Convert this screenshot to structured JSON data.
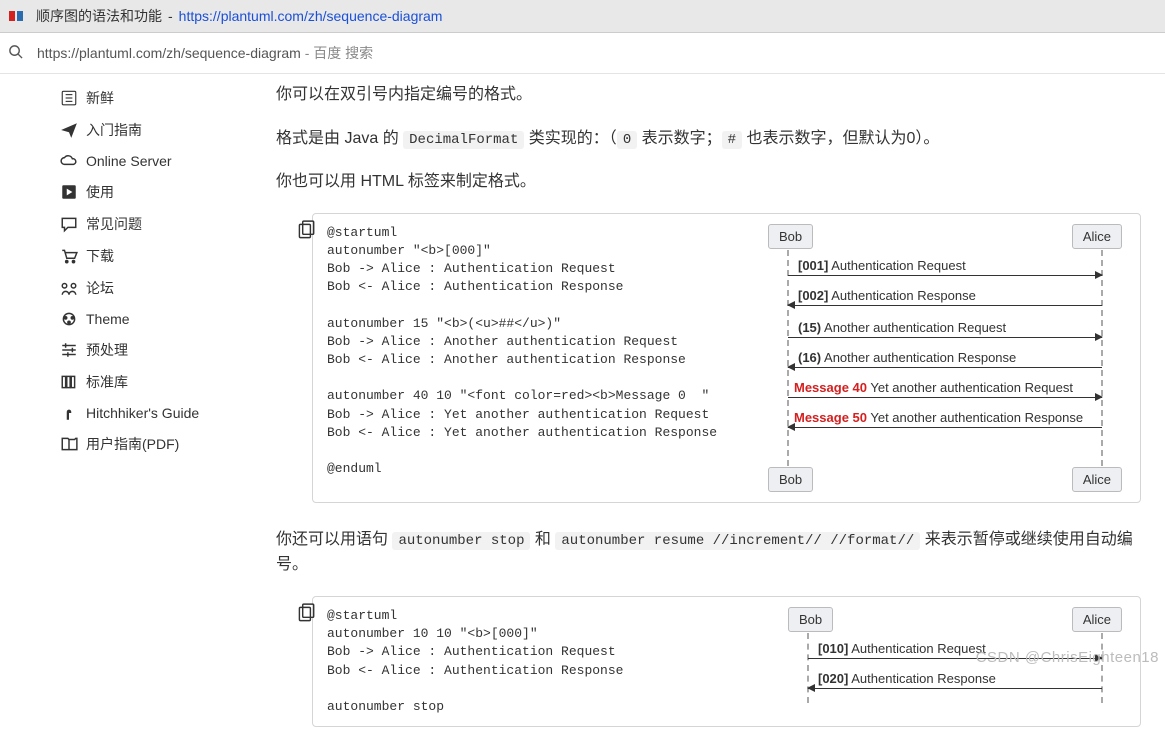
{
  "topbar": {
    "title": "顺序图的语法和功能",
    "sep": " - ",
    "url": "https://plantuml.com/zh/sequence-diagram"
  },
  "search": {
    "url": "https://plantuml.com/zh/sequence-diagram",
    "sep": " - ",
    "suffix": "百度 搜索"
  },
  "sidebar": {
    "items": [
      {
        "icon": "doc-icon",
        "label": "新鲜"
      },
      {
        "icon": "plane-icon",
        "label": "入门指南"
      },
      {
        "icon": "cloud-icon",
        "label": "Online Server"
      },
      {
        "icon": "play-icon",
        "label": "使用"
      },
      {
        "icon": "chat-icon",
        "label": "常见问题"
      },
      {
        "icon": "cart-icon",
        "label": "下载"
      },
      {
        "icon": "forum-icon",
        "label": "论坛"
      },
      {
        "icon": "theme-icon",
        "label": "Theme"
      },
      {
        "icon": "preprocess-icon",
        "label": "预处理"
      },
      {
        "icon": "library-icon",
        "label": "标准库"
      },
      {
        "icon": "hitchhiker-icon",
        "label": "Hitchhiker's Guide"
      },
      {
        "icon": "pdf-icon",
        "label": "用户指南(PDF)"
      }
    ]
  },
  "content": {
    "p1": "你可以在双引号内指定编号的格式。",
    "p2_a": "格式是由 Java 的 ",
    "p2_code": "DecimalFormat",
    "p2_b": " 类实现的：（",
    "p2_code2": "0",
    "p2_c": " 表示数字；",
    "p2_code3": "#",
    "p2_d": " 也表示数字，但默认为0）。",
    "p3": "你也可以用 HTML 标签来制定格式。",
    "code1": "@startuml\nautonumber \"<b>[000]\"\nBob -> Alice : Authentication Request\nBob <- Alice : Authentication Response\n\nautonumber 15 \"<b>(<u>##</u>)\"\nBob -> Alice : Another authentication Request\nBob <- Alice : Another authentication Response\n\nautonumber 40 10 \"<font color=red><b>Message 0  \"\nBob -> Alice : Yet another authentication Request\nBob <- Alice : Yet another authentication Response\n\n@enduml",
    "p4_a": "你还可以用语句 ",
    "p4_code1": "autonumber stop",
    "p4_b": " 和 ",
    "p4_code2": "autonumber resume //increment// //format//",
    "p4_c": " 来表示暂停或继续使用自动编号。",
    "code2": "@startuml\nautonumber 10 10 \"<b>[000]\"\nBob -> Alice : Authentication Request\nBob <- Alice : Authentication Response\n\nautonumber stop"
  },
  "diagram1": {
    "actors": {
      "bob": "Bob",
      "alice": "Alice"
    },
    "messages": [
      {
        "num": "[001]",
        "text": " Authentication Request",
        "dir": "fwd",
        "style": "bold"
      },
      {
        "num": "[002]",
        "text": " Authentication Response",
        "dir": "back",
        "style": "bold"
      },
      {
        "num": "(15)",
        "text": " Another authentication Request",
        "dir": "fwd",
        "style": "bold"
      },
      {
        "num": "(16)",
        "text": " Another authentication Response",
        "dir": "back",
        "style": "bold"
      },
      {
        "num": "Message 40",
        "text": "   Yet another authentication Request",
        "dir": "fwd",
        "style": "red"
      },
      {
        "num": "Message 50",
        "text": "   Yet another authentication Response",
        "dir": "back",
        "style": "red"
      }
    ]
  },
  "diagram2": {
    "actors": {
      "bob": "Bob",
      "alice": "Alice"
    },
    "messages": [
      {
        "num": "[010]",
        "text": " Authentication Request",
        "dir": "fwd"
      },
      {
        "num": "[020]",
        "text": " Authentication Response",
        "dir": "back"
      }
    ]
  },
  "watermark": "CSDN @ChrisEighteen18"
}
